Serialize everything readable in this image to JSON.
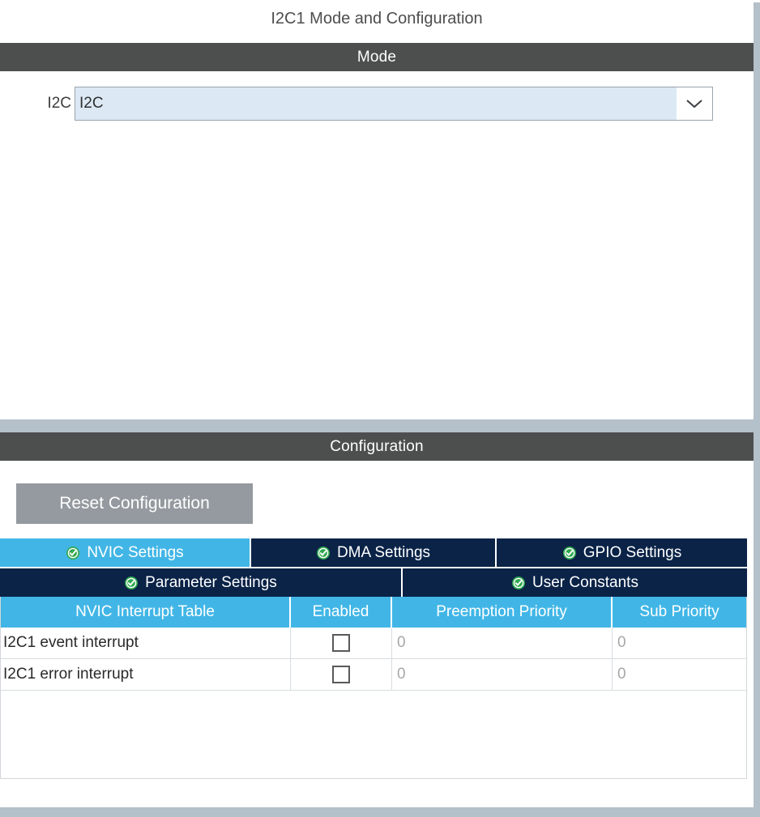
{
  "panel": {
    "title": "I2C1 Mode and Configuration"
  },
  "mode_section": {
    "header": "Mode",
    "i2c_label": "I2C",
    "i2c_select_value": "I2C",
    "i2c_select_placeholder": "I2C",
    "dropdown_icon": "chevron-down-icon"
  },
  "configuration_section": {
    "header": "Configuration",
    "reset_button": "Reset Configuration",
    "tabs_row1": [
      {
        "label": "NVIC Settings",
        "icon": "green-check-icon",
        "active": true
      },
      {
        "label": "DMA Settings",
        "icon": "green-check-icon",
        "active": false
      },
      {
        "label": "GPIO Settings",
        "icon": "green-check-icon",
        "active": false
      }
    ],
    "tabs_row2": [
      {
        "label": "Parameter Settings",
        "icon": "green-check-icon",
        "active": false
      },
      {
        "label": "User Constants",
        "icon": "green-check-icon",
        "active": false
      }
    ],
    "table": {
      "columns": [
        "NVIC Interrupt Table",
        "Enabled",
        "Preemption Priority",
        "Sub Priority"
      ],
      "rows": [
        {
          "name": "I2C1 event interrupt",
          "enabled": false,
          "preemption_priority": "0",
          "sub_priority": "0"
        },
        {
          "name": "I2C1 error interrupt",
          "enabled": false,
          "preemption_priority": "0",
          "sub_priority": "0"
        }
      ]
    }
  },
  "colors": {
    "accent_blue": "#41b6e6",
    "tab_navy": "#0a2347",
    "header_dark": "#4d4f4f",
    "divider_gray_blue": "#b4c0ca",
    "button_gray": "#949a9f",
    "combo_blue": "#dce9f5",
    "check_green": "#2fa84f"
  }
}
